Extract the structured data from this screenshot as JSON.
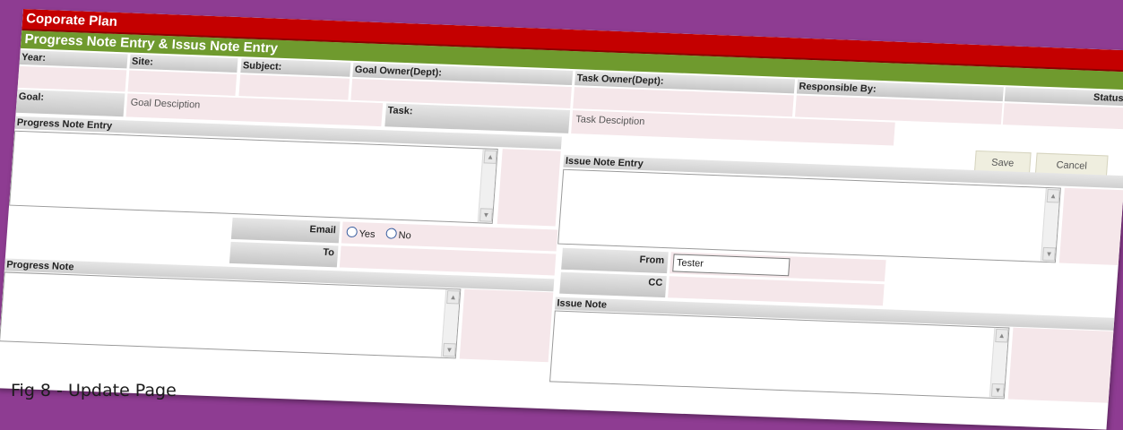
{
  "header": {
    "title": "Coporate Plan",
    "subtitle": "Progress Note Entry & Issus Note Entry"
  },
  "fields": {
    "year": "Year:",
    "site": "Site:",
    "subject": "Subject:",
    "goal_owner": "Goal Owner(Dept):",
    "task_owner": "Task Owner(Dept):",
    "responsible_by": "Responsible By:",
    "status": "Status:",
    "goal": "Goal:",
    "goal_value": "Goal Desciption",
    "task": "Task:",
    "task_value": "Task Desciption"
  },
  "sections": {
    "progress_entry": "Progress Note Entry",
    "issue_entry": "Issue Note Entry",
    "progress_note": "Progress Note",
    "issue_note": "Issue Note"
  },
  "buttons": {
    "save": "Save",
    "cancel": "Cancel"
  },
  "email": {
    "label": "Email",
    "yes": "Yes",
    "no": "No",
    "to_label": "To",
    "from_label": "From",
    "from_value": "Tester",
    "cc_label": "CC"
  },
  "caption": "Fig 8 - Update Page"
}
